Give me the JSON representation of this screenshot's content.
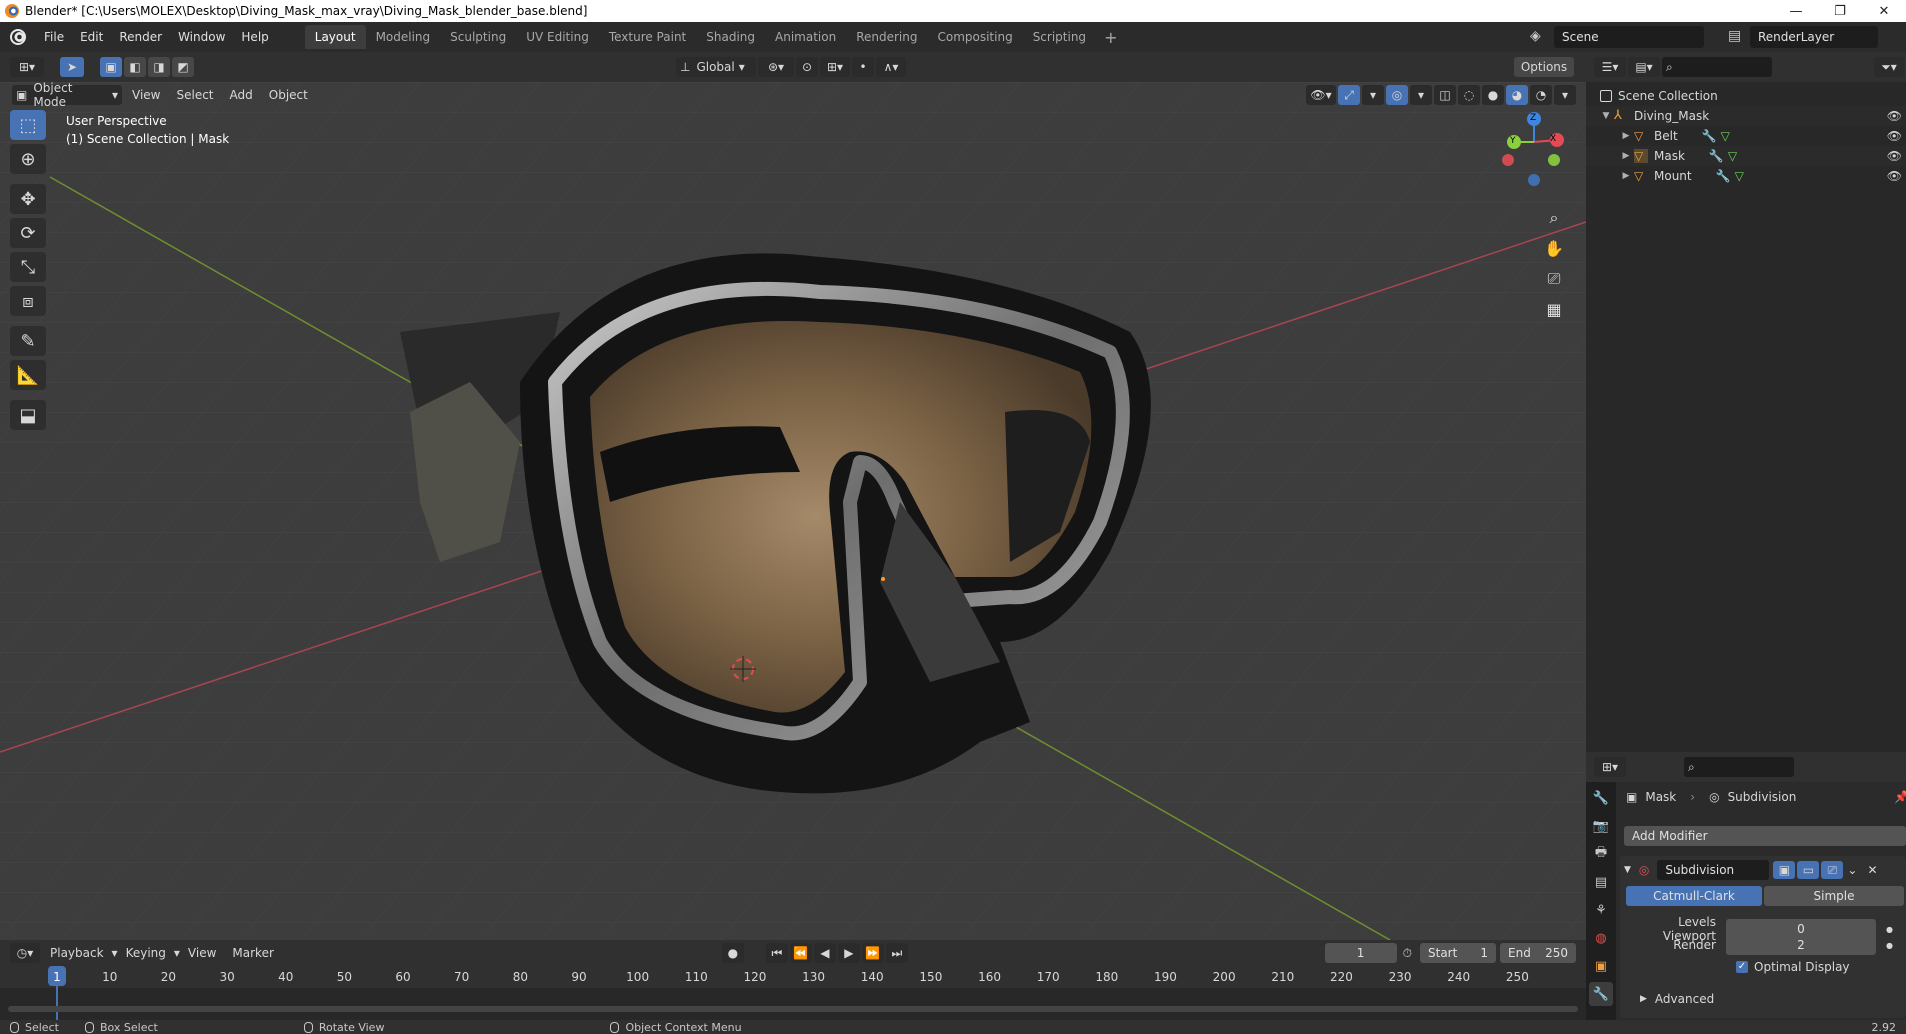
{
  "window": {
    "title": "Blender* [C:\\Users\\MOLEX\\Desktop\\Diving_Mask_max_vray\\Diving_Mask_blender_base.blend]",
    "minimize": "—",
    "restore": "❐",
    "close": "✕"
  },
  "menu": {
    "items": [
      "File",
      "Edit",
      "Render",
      "Window",
      "Help"
    ]
  },
  "workspaces": {
    "tabs": [
      "Layout",
      "Modeling",
      "Sculpting",
      "UV Editing",
      "Texture Paint",
      "Shading",
      "Animation",
      "Rendering",
      "Compositing",
      "Scripting"
    ],
    "active": "Layout",
    "add": "+"
  },
  "scene": {
    "name": "Scene",
    "render_layer": "RenderLayer"
  },
  "toolbar": {
    "transform_orientation": "Global",
    "options": "Options"
  },
  "viewport_header": {
    "mode": "Object Mode",
    "menus": [
      "View",
      "Select",
      "Add",
      "Object"
    ]
  },
  "viewport": {
    "perspective": "User Perspective",
    "collection": "(1) Scene Collection | Mask"
  },
  "gizmo": {
    "x": "X",
    "y": "Y",
    "z": "Z"
  },
  "outliner": {
    "root": "Scene Collection",
    "collection": "Diving_Mask",
    "objects": [
      "Belt",
      "Mask",
      "Mount"
    ]
  },
  "properties": {
    "object": "Mask",
    "modifier_crumb": "Subdivision",
    "add_modifier": "Add Modifier",
    "modifier_name": "Subdivision",
    "algorithms": [
      "Catmull-Clark",
      "Simple"
    ],
    "active_algorithm": "Catmull-Clark",
    "levels_viewport_label": "Levels Viewport",
    "levels_viewport": "0",
    "render_label": "Render",
    "render_levels": "2",
    "optimal_display": "Optimal Display",
    "advanced": "Advanced"
  },
  "timeline": {
    "menus": [
      "Playback",
      "Keying",
      "View",
      "Marker"
    ],
    "current_frame": "1",
    "start_label": "Start",
    "start": "1",
    "end_label": "End",
    "end": "250",
    "ticks": [
      "1",
      "10",
      "20",
      "30",
      "40",
      "50",
      "60",
      "70",
      "80",
      "90",
      "100",
      "110",
      "120",
      "130",
      "140",
      "150",
      "160",
      "170",
      "180",
      "190",
      "200",
      "210",
      "220",
      "230",
      "240",
      "250"
    ]
  },
  "statusbar": {
    "items": [
      "Select",
      "Box Select",
      "Rotate View",
      "Object Context Menu"
    ],
    "version": "2.92"
  },
  "colors": {
    "accent": "#4772b3",
    "x_axis": "#e04b54",
    "y_axis": "#8ad03e",
    "z_axis": "#3f86e0",
    "viewport_bg": "#3d3d3d"
  }
}
